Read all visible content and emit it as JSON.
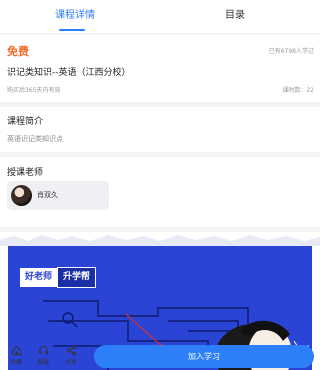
{
  "tabs": [
    {
      "label": "课程详情",
      "active": true
    },
    {
      "label": "目录",
      "active": false
    }
  ],
  "course": {
    "price": "免费",
    "learners": "已有6798人学过",
    "title": "识记类知识--英语（江西分校）",
    "validity": "购买后365天内有效",
    "lessons": "课时数：22"
  },
  "intro": {
    "heading": "课程简介",
    "body": "英语识记类知识点"
  },
  "teachers": {
    "heading": "授课老师",
    "list": [
      {
        "name": "肖双久"
      }
    ]
  },
  "banner": {
    "brand_left": "好老师",
    "brand_right": "升学帮"
  },
  "bottom_bar": {
    "favorite": "收藏",
    "service": "客服",
    "share": "分享",
    "join": "加入学习"
  },
  "colors": {
    "accent": "#2d7ff9",
    "price": "#f36b2c",
    "banner": "#2a44d6"
  }
}
